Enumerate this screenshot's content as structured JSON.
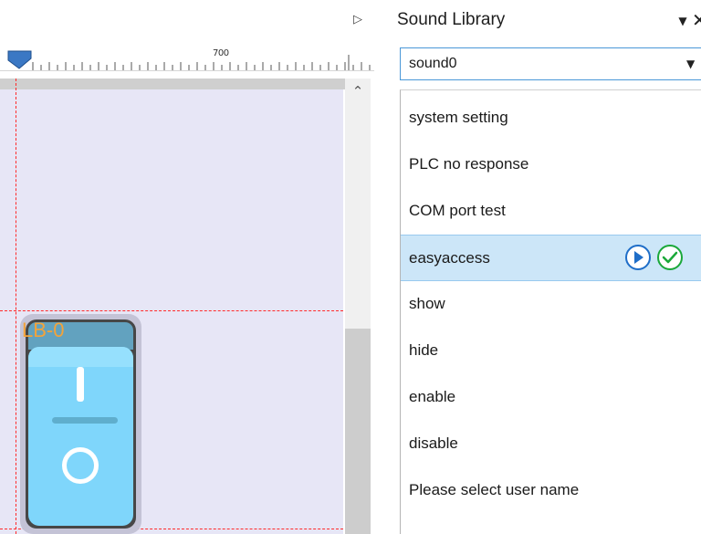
{
  "editor": {
    "tab_arrow_icon": "triangle-right-icon",
    "ruler_label": "700",
    "scroll_up_icon": "chevron-up-icon",
    "switch_label": "LB-0",
    "switch_colors": {
      "label": "#f3a33a",
      "face": "#7fd6fb",
      "frame": "#474747"
    },
    "canvas_color": "#e7e6f6",
    "guide_color": "#ff2a2a"
  },
  "sound_panel": {
    "title": "Sound Library",
    "menu_icon": "dropdown-triangle-icon",
    "close_icon": "close-x-icon",
    "selected_sound": "sound0",
    "items": [
      {
        "label": "system setting"
      },
      {
        "label": "PLC no response"
      },
      {
        "label": "COM port test"
      },
      {
        "label": "easyaccess",
        "selected": true
      },
      {
        "label": "show"
      },
      {
        "label": "hide"
      },
      {
        "label": "enable"
      },
      {
        "label": "disable"
      },
      {
        "label": "Please select user name"
      }
    ],
    "selection_color": "#cce6f8",
    "play_icon": "play-circle-icon",
    "confirm_icon": "check-circle-icon"
  }
}
